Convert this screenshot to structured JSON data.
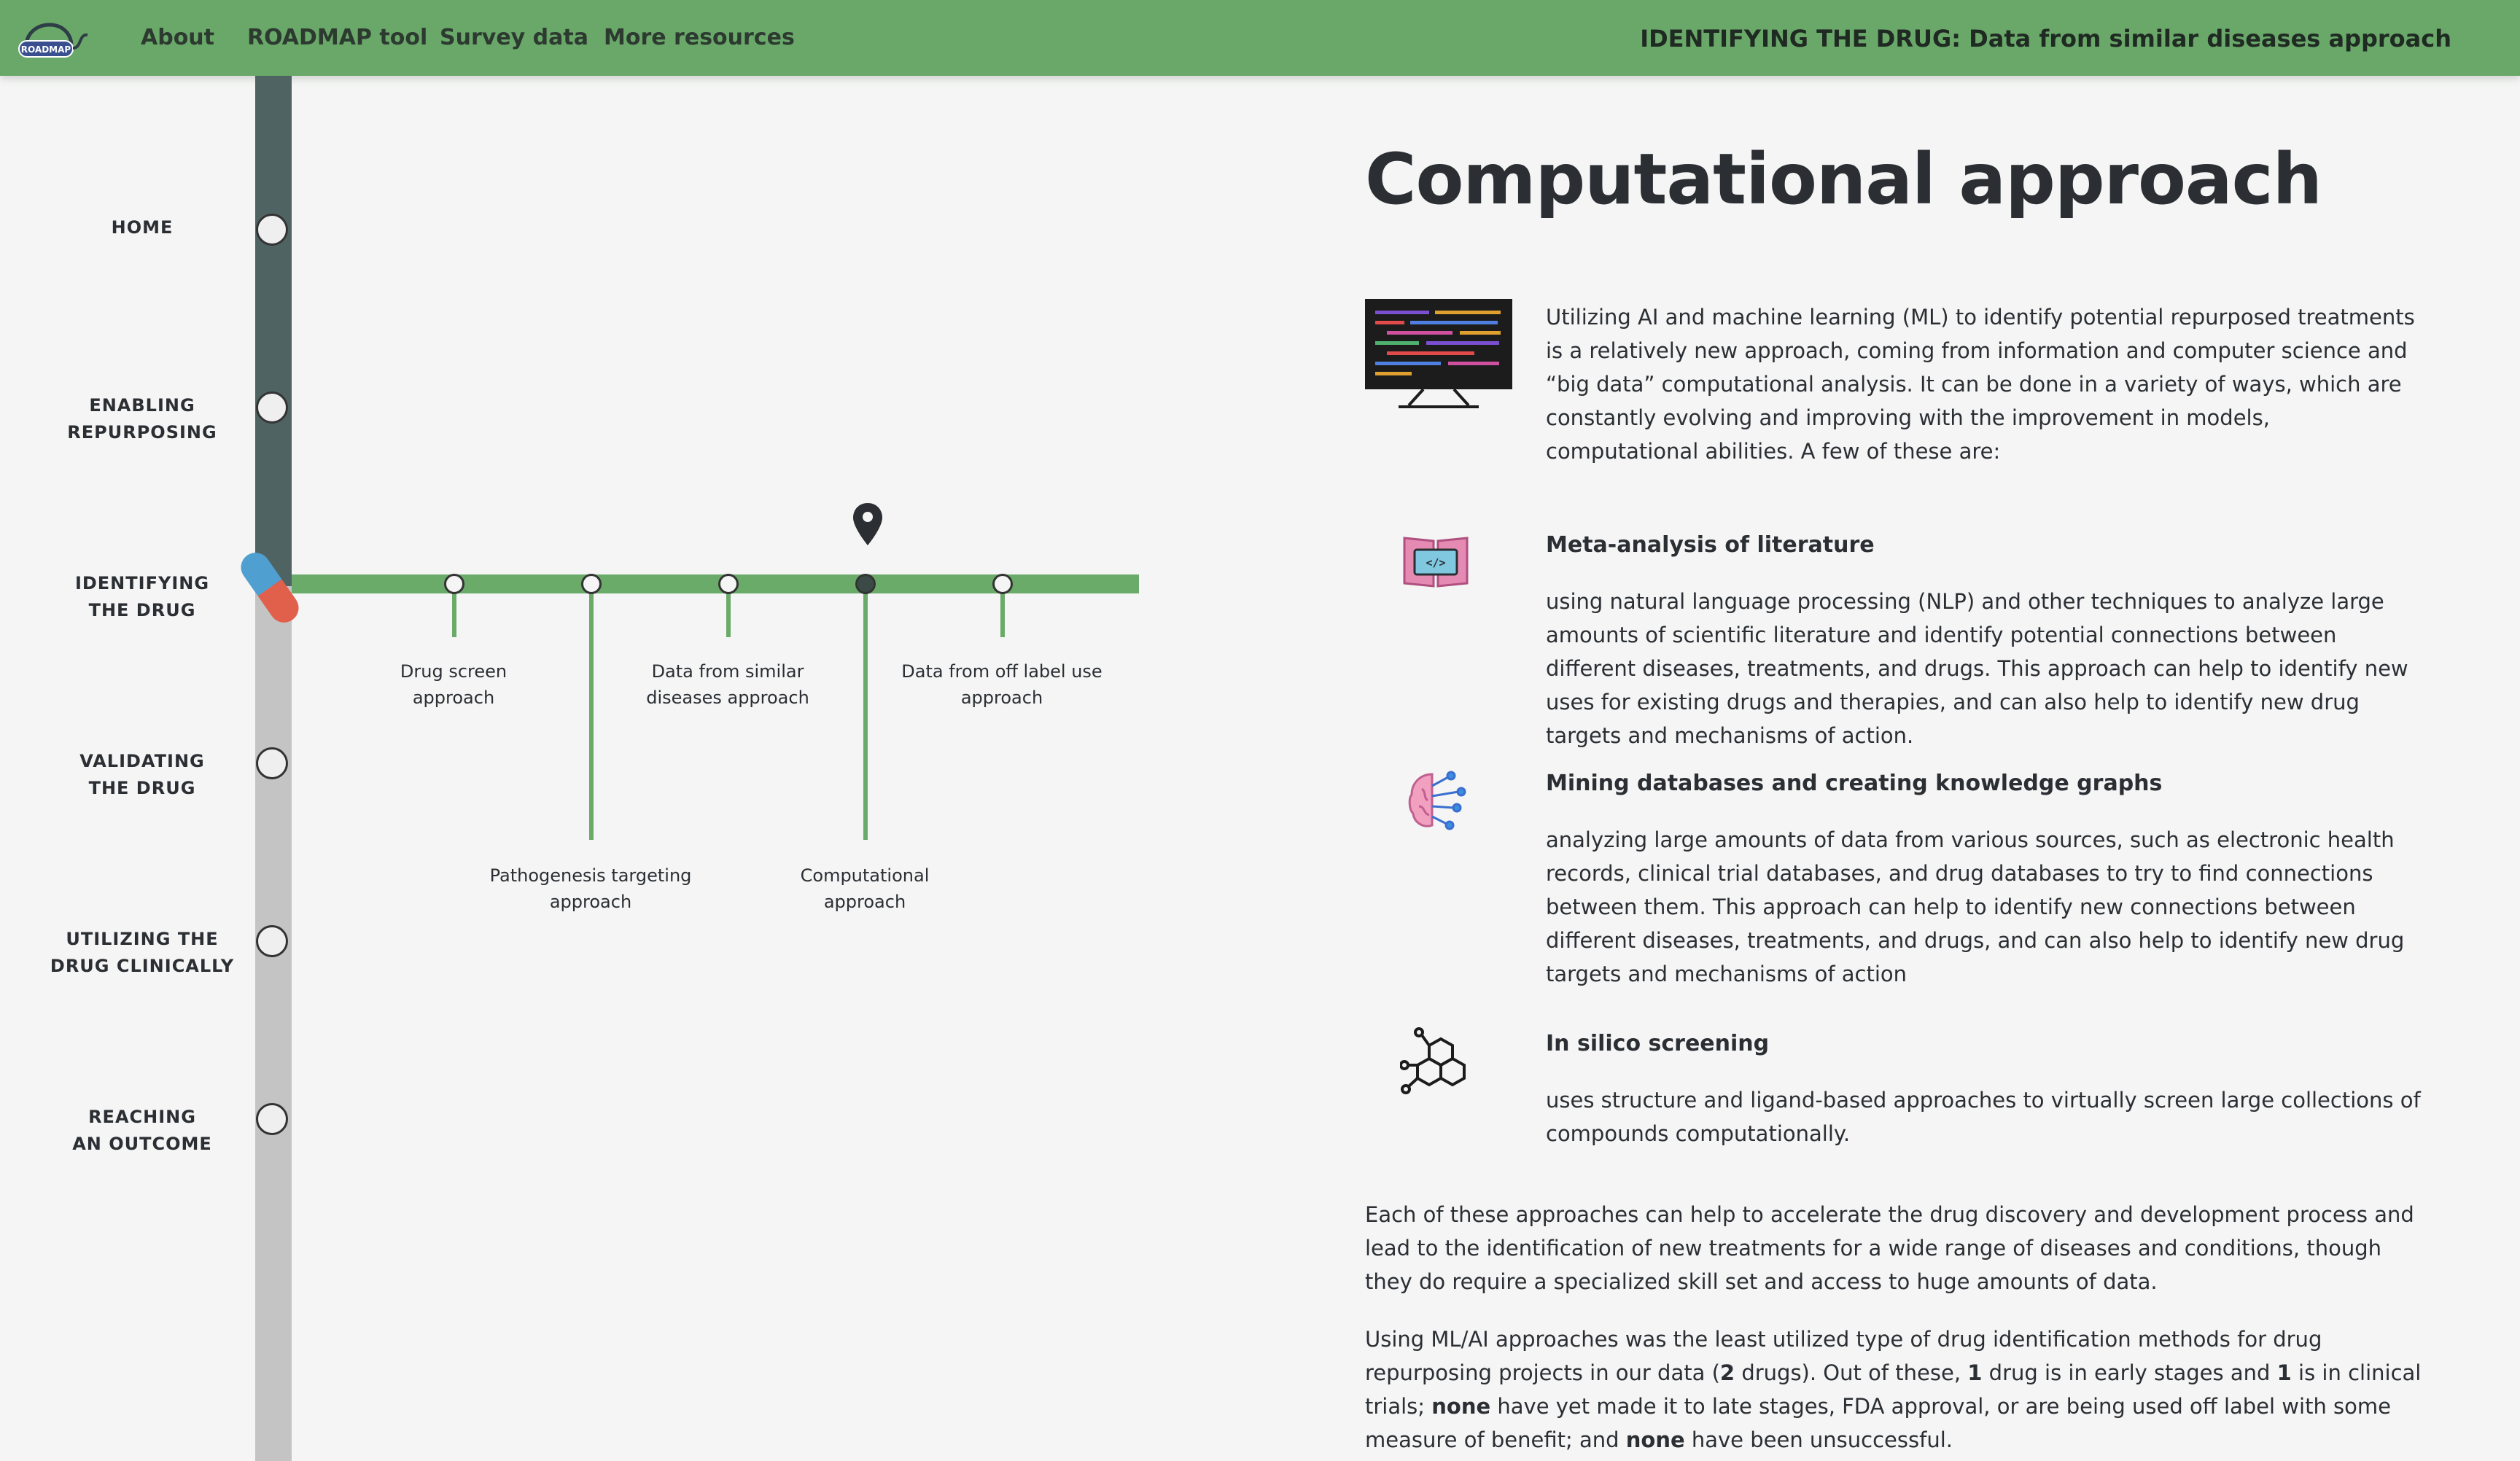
{
  "nav": {
    "logo_text": "ROADMAP",
    "links": [
      "About",
      "ROADMAP tool",
      "Survey data",
      "More resources"
    ],
    "page_context": "IDENTIFYING THE DRUG: Data from similar diseases approach"
  },
  "timeline": {
    "stages": [
      {
        "line1": "HOME",
        "line2": ""
      },
      {
        "line1": "ENABLING",
        "line2": "REPURPOSING"
      },
      {
        "line1": "IDENTIFYING",
        "line2": "THE DRUG"
      },
      {
        "line1": "VALIDATING",
        "line2": "THE DRUG"
      },
      {
        "line1": "UTILIZING THE",
        "line2": "DRUG CLINICALLY"
      },
      {
        "line1": "REACHING",
        "line2": "AN OUTCOME"
      }
    ],
    "approaches": [
      {
        "line1": "Drug screen",
        "line2": "approach"
      },
      {
        "line1": "Pathogenesis targeting",
        "line2": "approach"
      },
      {
        "line1": "Data from similar",
        "line2": "diseases approach"
      },
      {
        "line1": "Computational",
        "line2": "approach"
      },
      {
        "line1": "Data from off label use",
        "line2": "approach"
      }
    ],
    "current_approach": "Computational approach"
  },
  "main": {
    "title": "Computational approach",
    "intro": "Utilizing AI and machine learning (ML) to identify potential repurposed treatments is a relatively new approach, coming from information and computer science and “big data” computational analysis. It can be done in a variety of ways, which are constantly evolving and improving with the improvement in models, computational abilities. A few of these are:",
    "methods": [
      {
        "icon": "code-book-icon",
        "title": "Meta-analysis of literature",
        "text": "using natural language processing (NLP) and other techniques to analyze large amounts of scientific literature and identify potential connections between different diseases, treatments, and drugs. This approach can help to identify new uses for existing drugs and therapies, and can also help to identify new drug targets and mechanisms of action."
      },
      {
        "icon": "brain-network-icon",
        "title": "Mining databases and creating knowledge graphs",
        "text": "analyzing large amounts of data from various sources, such as electronic health records, clinical trial databases, and drug databases to try to find connections between them. This approach can help to identify new connections between different diseases, treatments, and drugs, and can also help to identify new drug targets and mechanisms of action"
      },
      {
        "icon": "molecule-icon",
        "title": "In silico screening",
        "text": "uses structure and ligand-based approaches to virtually screen large collections of compounds computationally."
      }
    ],
    "summary": "Each of these approaches can help to accelerate the drug discovery and development process and lead to the identification of new treatments for a wide range of diseases and conditions, though they do require a specialized skill set and access to huge amounts of data.",
    "stats": {
      "p1": "Using ML/AI approaches was the least utilized type of drug identification methods for drug repurposing projects in our data (",
      "total": "2",
      "p2": " drugs). Out of these, ",
      "early": "1",
      "p3": " drug is in early stages and ",
      "trials": "1",
      "p4": " is in clinical trials; ",
      "none1": "none",
      "p5": " have yet made it to late stages, FDA approval, or are being used off label with some measure of benefit; and ",
      "none2": "none",
      "p6": " have been unsuccessful."
    }
  },
  "colors": {
    "nav_green": "#6aa86a",
    "branch_green": "#6aab6a",
    "track_dark": "#4f6462",
    "track_light": "#c4c4c4"
  }
}
